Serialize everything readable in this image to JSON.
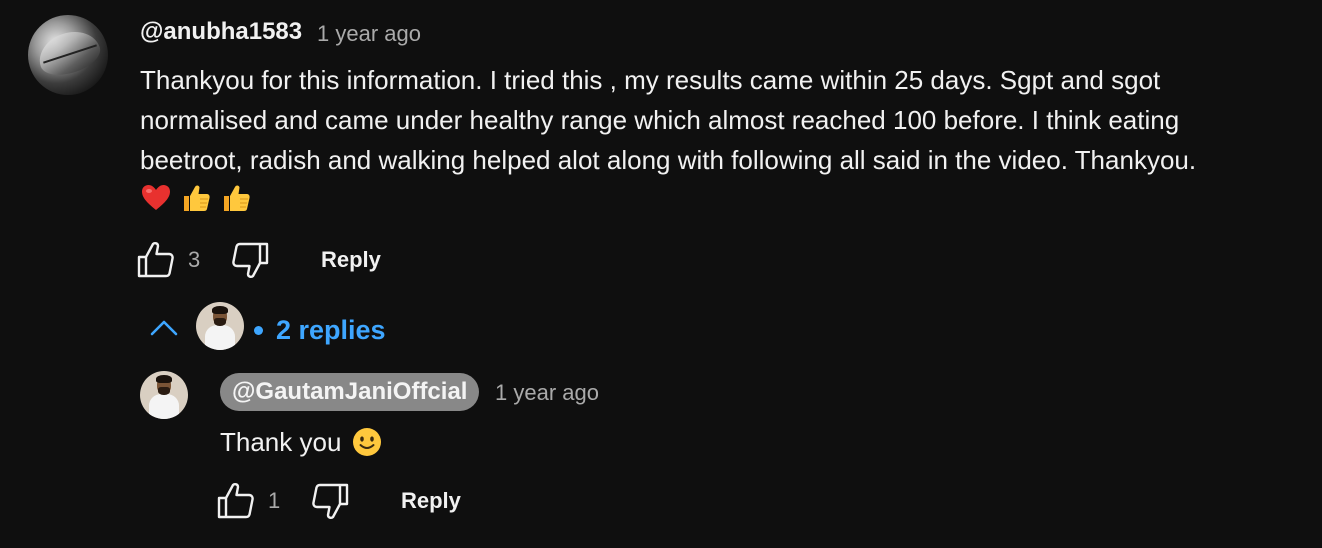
{
  "comment": {
    "author": "@anubha1583",
    "timestamp": "1 year ago",
    "text_lines": [
      "Thankyou for this information. I tried this , my results came within 25 days. Sgpt and sgot",
      "normalised and came under healthy range which almost reached 100 before. I think eating",
      "beetroot, radish and walking helped alot along with following all said in the video. Thankyou."
    ],
    "emojis": [
      "red-heart",
      "thumbs-up",
      "thumbs-up"
    ],
    "like_count": "3",
    "reply_label": "Reply"
  },
  "replies_toggle": {
    "label": "2 replies",
    "expanded": true
  },
  "reply": {
    "author": "@GautamJaniOffcial",
    "timestamp": "1 year ago",
    "text": "Thank you",
    "emoji": "slightly-smiling-face",
    "like_count": "1",
    "reply_label": "Reply"
  },
  "colors": {
    "background": "#0f0f0f",
    "text": "#f1f1f1",
    "secondary_text": "#aaaaaa",
    "link_blue": "#3ea6ff",
    "owner_badge": "#888888"
  }
}
